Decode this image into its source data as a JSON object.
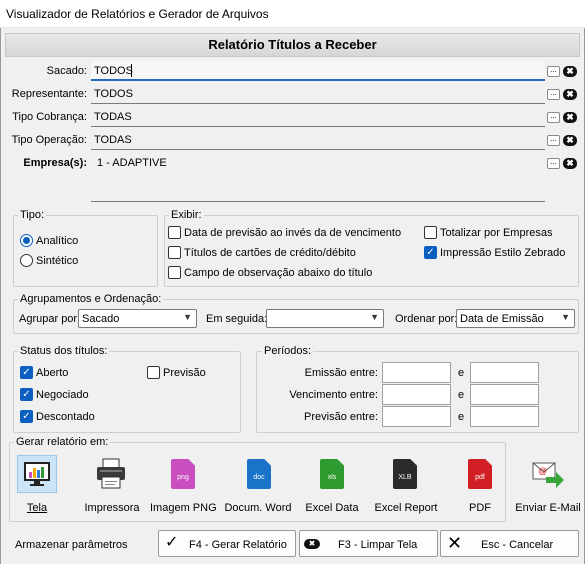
{
  "window": {
    "title": "Visualizador de Relatórios e Gerador de Arquivos"
  },
  "header": {
    "title": "Relatório Títulos a Receber"
  },
  "fields": [
    {
      "label": "Sacado:",
      "value": "TODOS"
    },
    {
      "label": "Representante:",
      "value": "TODOS"
    },
    {
      "label": "Tipo Cobrança:",
      "value": "TODAS"
    },
    {
      "label": "Tipo Operação:",
      "value": "TODAS"
    }
  ],
  "empresa": {
    "label": "Empresa(s):",
    "value": "1 - ADAPTIVE"
  },
  "field_buttons": {
    "dots": "...",
    "clear": "✖"
  },
  "tipo": {
    "title": "Tipo:",
    "options": [
      {
        "label": "Analítico",
        "selected": true
      },
      {
        "label": "Sintético",
        "selected": false
      }
    ]
  },
  "exibir": {
    "title": "Exibir:",
    "options": [
      {
        "label": "Data de previsão ao invés da de vencimento",
        "checked": false
      },
      {
        "label": "Títulos de cartões de crédito/débito",
        "checked": false
      },
      {
        "label": "Campo de observação abaixo do título",
        "checked": false
      },
      {
        "label": "Totalizar por Empresas",
        "checked": false
      },
      {
        "label": "Impressão Estilo Zebrado",
        "checked": true
      }
    ]
  },
  "agrupamentos": {
    "title": "Agrupamentos e Ordenação:",
    "agrupar_label": "Agrupar por",
    "agrupar_value": "Sacado",
    "em_seguida_label": "Em seguida:",
    "em_seguida_value": "",
    "ordenar_label": "Ordenar por:",
    "ordenar_value": "Data de Emissão"
  },
  "status": {
    "title": "Status dos títulos:",
    "options": [
      {
        "label": "Aberto",
        "checked": true
      },
      {
        "label": "Negociado",
        "checked": true
      },
      {
        "label": "Descontado",
        "checked": true
      },
      {
        "label": "Previsão",
        "checked": false
      }
    ]
  },
  "periodos": {
    "title": "Períodos:",
    "rows": [
      {
        "label": "Emissão entre:",
        "from": "",
        "sep": "e",
        "to": ""
      },
      {
        "label": "Vencimento entre:",
        "from": "",
        "sep": "e",
        "to": ""
      },
      {
        "label": "Previsão entre:",
        "from": "",
        "sep": "e",
        "to": ""
      }
    ]
  },
  "gerar": {
    "title": "Gerar relatório em:",
    "outputs": [
      {
        "label": "Tela",
        "icon": "screen-chart-icon",
        "selected": true
      },
      {
        "label": "Impressora",
        "icon": "printer-icon"
      },
      {
        "label": "Imagem PNG",
        "icon": "png-file-icon",
        "badge": "png",
        "color": "#c94fbf"
      },
      {
        "label": "Docum. Word",
        "icon": "word-file-icon",
        "badge": "doc",
        "color": "#1a73c9"
      },
      {
        "label": "Excel Data",
        "icon": "excel-data-file-icon",
        "badge": "xls",
        "color": "#2f9a2f"
      },
      {
        "label": "Excel Report",
        "icon": "excel-report-file-icon",
        "badge": "XLB",
        "color": "#2b2b2b"
      },
      {
        "label": "PDF",
        "icon": "pdf-file-icon",
        "badge": "pdf",
        "color": "#d21f26"
      },
      {
        "label": "Enviar E-Mail",
        "icon": "email-icon"
      }
    ]
  },
  "footer": {
    "armazenar": "Armazenar parâmetros",
    "gerar_btn": "F4 - Gerar Relatório",
    "limpar_btn": "F3 - Limpar Tela",
    "cancelar_btn": "Esc - Cancelar"
  },
  "colors": {
    "accent": "#0b5fc0",
    "field_focus": "#1f6fc0"
  }
}
